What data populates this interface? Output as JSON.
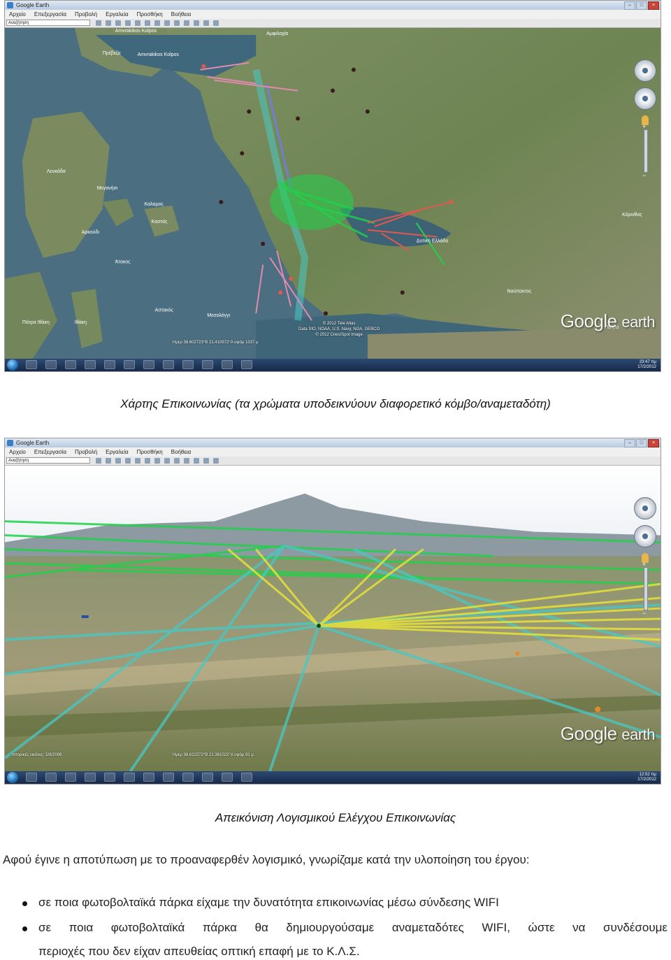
{
  "screenshot1": {
    "window_title": "Google Earth",
    "menu": [
      "Αρχείο",
      "Επεξεργασία",
      "Προβολή",
      "Εργαλεία",
      "Προσθήκη",
      "Βοήθεια"
    ],
    "search_placeholder": "Αναζήτηση",
    "place_labels": [
      "Amvrakikos Kolpos",
      "Amvrakikos Kolpos",
      "Πρέβεζα",
      "Αμφιλοχία",
      "Λευκάδα",
      "Μεγανήσι",
      "Καλαμος",
      "Καστός",
      "Άτοκος",
      "Αρκούδι",
      "Ιθάκη",
      "Αστακός",
      "Μεσολόγγι",
      "Ναύπακτος",
      "Πάτρα",
      "Δυτική Ελλάδα",
      "Πάτρα Ιθάκη",
      "Κόρινθος"
    ],
    "credits": [
      "© 2012 Tele Atlas",
      "Data SIO, NOAA, U.S. Navy, NGA, GEBCO",
      "© 2012 Cnes/Spot Image"
    ],
    "status": "Ημερ  38.602723°Β  21.410972°A  υψόμ  1337 μ",
    "clock_time": "23:47 πμ",
    "clock_date": "17/2/2012",
    "brand_google": "Google",
    "brand_earth": "earth"
  },
  "caption1": "Χάρτης Επικοινωνίας (τα χρώματα υποδεικνύουν διαφορετικό κόμβο/αναμεταδότη)",
  "screenshot2": {
    "window_title": "Google Earth",
    "menu": [
      "Αρχείο",
      "Επεξεργασία",
      "Προβολή",
      "Εργαλεία",
      "Προσθήκη",
      "Βοήθεια"
    ],
    "search_placeholder": "Αναζήτηση",
    "status_left": "Ιστορικές εικόνες: 5/8/2006",
    "status": "Ημερ  38.612272°Β  21.361022°A  υψόμ  91 μ",
    "clock_time": "12:52 πμ",
    "clock_date": "17/2/2012",
    "brand_google": "Google",
    "brand_earth": "earth"
  },
  "caption2": "Απεικόνιση Λογισμικού Ελέγχου Επικοινωνίας",
  "paragraph": "Αφού έγινε η αποτύπωση με το προαναφερθέν λογισμικό, γνωρίζαμε κατά την υλοποίηση του έργου:",
  "bullets": [
    "σε ποια φωτοβολταϊκά πάρκα είχαμε την δυνατότητα επικοινωνίας μέσω σύνδεσης WIFI",
    "σε ποια φωτοβολταϊκά πάρκα θα δημιουργούσαμε αναμεταδότες WIFI, ώστε να συνδέσουμε",
    "περιοχές που δεν είχαν απευθείας οπτική επαφή με το Κ.Λ.Σ."
  ],
  "colors": {
    "sea": "#4b6f80",
    "land": "#6f8a55",
    "green_links": "#21d14a",
    "cyan_links": "#48c8c4",
    "yellow_links": "#e7e23a",
    "red_links": "#e2584f",
    "pink_links": "#e08ab0"
  }
}
